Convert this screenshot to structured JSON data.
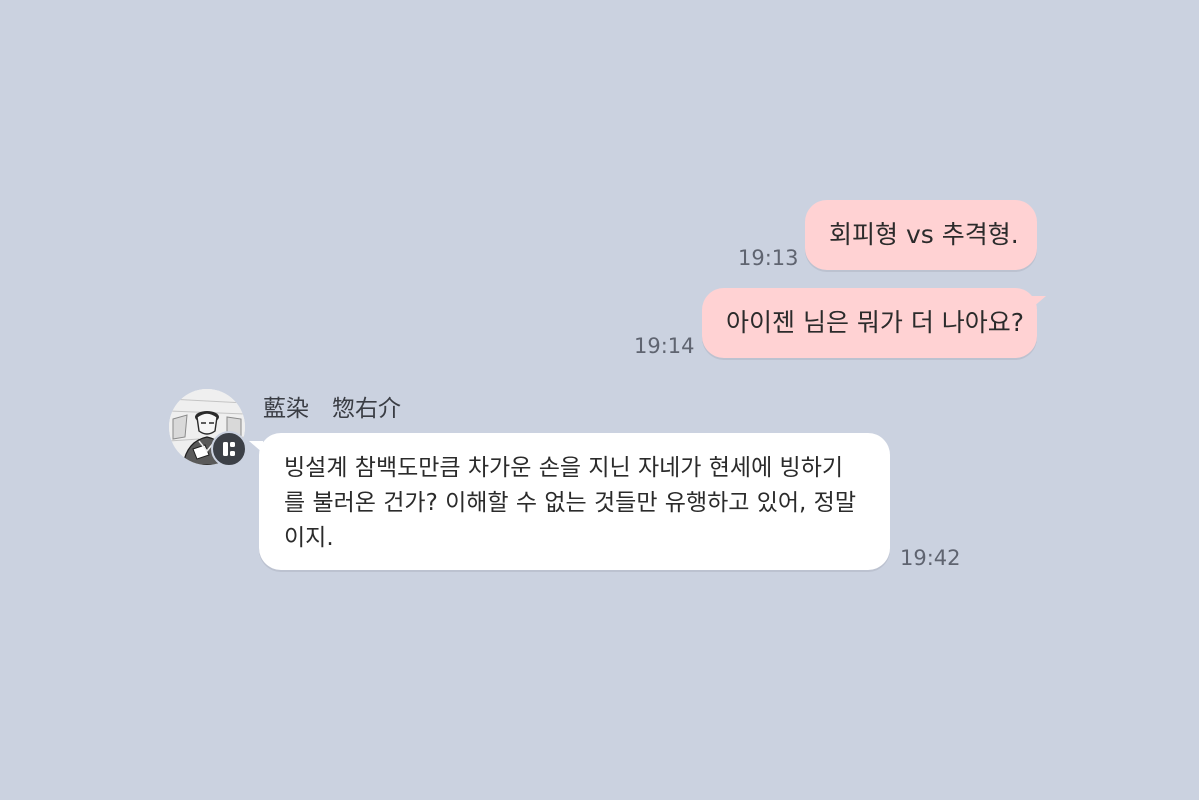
{
  "messages": {
    "outgoing": [
      {
        "text": "회피형 vs 추격형.",
        "time": "19:13"
      },
      {
        "text": "아이젠 님은 뭐가 더 나아요?",
        "time": "19:14"
      }
    ],
    "incoming": {
      "sender_name": "藍染　惣右介",
      "text": "빙설계 참백도만큼 차가운 손을 지닌 자네가 현세에 빙하기를 불러온 건가? 이해할 수 없는 것들만 유행하고 있어, 정말이지.",
      "time": "19:42",
      "avatar_icon": "character-portrait-icon",
      "badge_icon": "app-badge-icon"
    }
  },
  "colors": {
    "background": "#cbd2e0",
    "outgoing_bubble": "#ffd2d3",
    "incoming_bubble": "#ffffff",
    "timestamp": "#5f6470"
  }
}
